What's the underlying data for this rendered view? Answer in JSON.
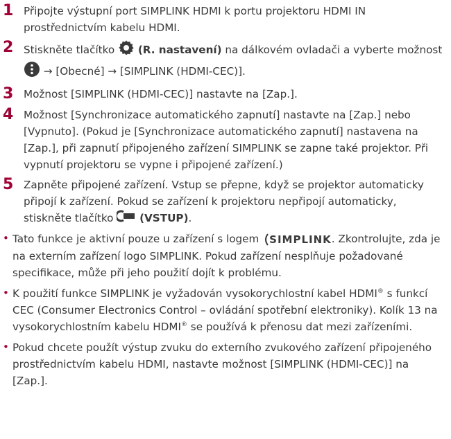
{
  "accent_color": "#a50034",
  "steps": [
    {
      "num": "1",
      "text": "Připojte výstupní port SIMPLINK HDMI k portu projektoru HDMI IN prostřednictvím kabelu HDMI."
    },
    {
      "num": "2",
      "pre": "Stiskněte tlačítko ",
      "bold": "(R. nastavení)",
      "mid": " na dálkovém ovladači a vyberte možnost ",
      "post": " → [Obecné] → [SIMPLINK (HDMI-CEC)].",
      "icon1": "gear-icon",
      "icon2": "menu-dots-icon"
    },
    {
      "num": "3",
      "text": "Možnost [SIMPLINK (HDMI-CEC)] nastavte na [Zap.]."
    },
    {
      "num": "4",
      "text": "Možnost [Synchronizace automatického zapnutí] nastavte na [Zap.] nebo [Vypnuto]. (Pokud je [Synchronizace automatického zapnutí] nastavena na [Zap.], při zapnutí připojeného zařízení SIMPLINK se zapne také projektor. Při vypnutí projektoru se vypne i připojené zařízení.)"
    },
    {
      "num": "5",
      "pre": "Zapněte připojené zařízení. Vstup se přepne, když se projektor automaticky připojí k zařízení. Pokud se zařízení k projektoru nepřipojí automaticky, stiskněte tlačítko ",
      "bold": "(VSTUP)",
      "post": ".",
      "icon1": "input-icon"
    }
  ],
  "bullets": [
    {
      "pre": "Tato funkce je aktivní pouze u zařízení s logem ",
      "logo": "SIMPLINK",
      "post": ". Zkontrolujte, zda je na externím zařízení logo SIMPLINK. Pokud zařízení nesplňuje požadované specifikace, může při jeho použití dojít k problému."
    },
    {
      "a": "K použití funkce SIMPLINK je vyžadován vysokorychlostní kabel HDMI",
      "reg": "®",
      "b": " s funkcí CEC (Consumer Electronics Control – ovládání spotřební elektroniky). Kolík 13 na vysokorychlostním kabelu HDMI",
      "c": " se používá k přenosu dat mezi zařízeními."
    },
    {
      "text": "Pokud chcete použít výstup zvuku do externího zvukového zařízení připojeného prostřednictvím kabelu HDMI, nastavte možnost [SIMPLINK (HDMI-CEC)] na [Zap.]."
    }
  ],
  "bullet_char": "•"
}
